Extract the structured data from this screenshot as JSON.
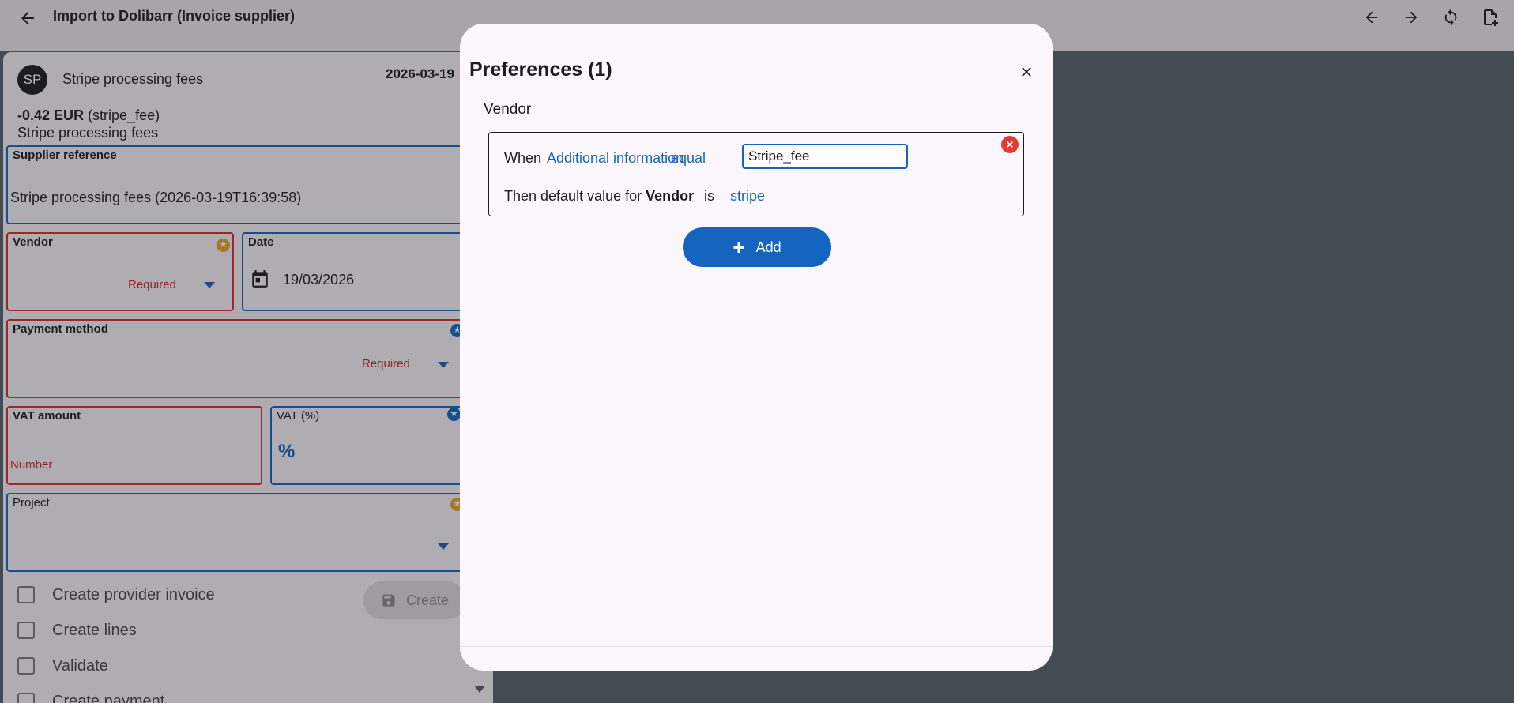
{
  "header": {
    "title": "Import to Dolibarr (Invoice supplier)"
  },
  "transaction": {
    "avatar_initials": "SP",
    "name": "Stripe processing fees",
    "date": "2026-03-19",
    "amount": "-0.42 EUR",
    "amount_tag": "(stripe_fee)",
    "description": "Stripe processing fees"
  },
  "form": {
    "supplier_reference": {
      "label": "Supplier reference",
      "value": "Stripe processing fees (2026-03-19T16:39:58)"
    },
    "vendor": {
      "label": "Vendor",
      "hint": "Required"
    },
    "date": {
      "label": "Date",
      "value": "19/03/2026"
    },
    "payment_method": {
      "label": "Payment method",
      "hint": "Required"
    },
    "vat_amount": {
      "label": "VAT amount",
      "hint": "Number"
    },
    "vat_percent": {
      "label": "VAT (%)"
    },
    "project": {
      "label": "Project"
    }
  },
  "options": [
    {
      "label": "Create provider invoice",
      "checked": false
    },
    {
      "label": "Create lines",
      "checked": false
    },
    {
      "label": "Validate",
      "checked": false
    },
    {
      "label": "Create payment",
      "checked": false
    }
  ],
  "create_button": {
    "label": "Create"
  },
  "dialog": {
    "title": "Preferences (1)",
    "section": "Vendor",
    "rule": {
      "when": "When",
      "field": "Additional information",
      "operator": "equal",
      "value": "Stripe_fee",
      "then_prefix": "Then default value for",
      "then_field": "Vendor",
      "is": "is",
      "result": "stripe"
    },
    "add_label": "Add"
  },
  "colors": {
    "primary": "#1565c0",
    "error": "#d32f2f",
    "star_gold": "#e0a42a"
  }
}
